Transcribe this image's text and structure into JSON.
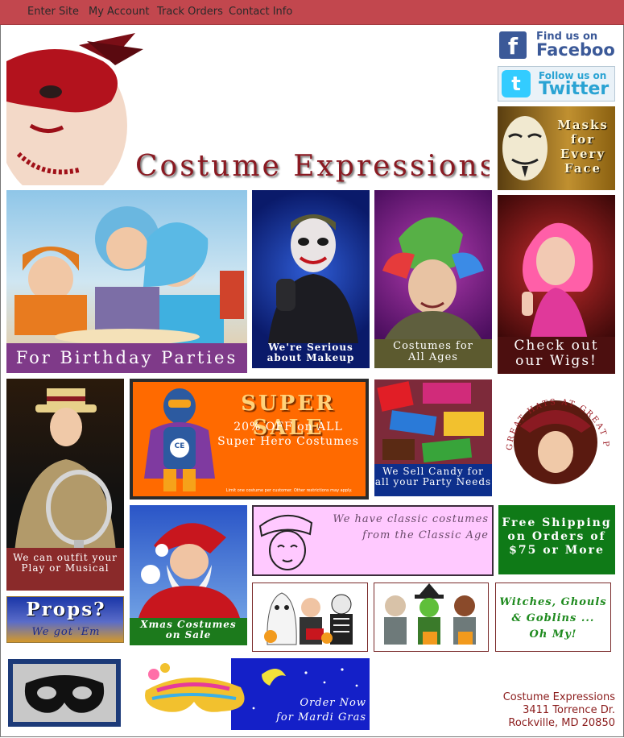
{
  "nav": {
    "items": [
      "Enter Site",
      "My Account",
      "Track Orders",
      "Contact Info"
    ]
  },
  "header": {
    "brand": "Costume Expressions"
  },
  "social": {
    "facebook_line1": "Find us on",
    "facebook_line2": "Facebook",
    "twitter_line1": "Follow us on",
    "twitter_line2": "Twitter"
  },
  "tiles": {
    "masks": "Masks for Every Face",
    "birthday": "For Birthday Parties",
    "makeup_line1": "We're Serious",
    "makeup_line2": "about Makeup",
    "ages_line1": "Costumes for",
    "ages_line2": "All Ages",
    "wigs_line1": "Check out",
    "wigs_line2": "our Wigs!",
    "play_line1": "We can outfit your",
    "play_line2": "Play or Musical",
    "sale_title": "SUPER SALE",
    "sale_line1": "20% OFF on ALL",
    "sale_line2": "Super Hero Costumes",
    "sale_fine": "Limit one costume per customer. Other restrictions may apply.",
    "sale_badge": "CE",
    "candy_line1": "We Sell Candy for",
    "candy_line2": "all your Party Needs",
    "hats_arc": "GREAT HATS AT GREAT PRICES",
    "props_title": "Props?",
    "props_sub": "We got 'Em",
    "xmas_line1": "Xmas Costumes",
    "xmas_line2": "on Sale",
    "classic_line1": "We have classic costumes",
    "classic_line2": "from the Classic Age",
    "shipping_line1": "Free Shipping",
    "shipping_line2": "on Orders of",
    "shipping_line3": "$75 or More",
    "witches_line1": "Witches, Ghouls",
    "witches_line2": "& Goblins ...",
    "witches_line3": "Oh My!",
    "mardi_line1": "Order Now",
    "mardi_line2": "for Mardi Gras"
  },
  "address": {
    "name": "Costume Expressions",
    "street": "3411 Torrence Dr.",
    "city": "Rockville, MD 20850"
  },
  "colors": {
    "nav_bg": "#c2474e",
    "brand_red": "#8a1a22",
    "address_red": "#8b1c1c"
  }
}
